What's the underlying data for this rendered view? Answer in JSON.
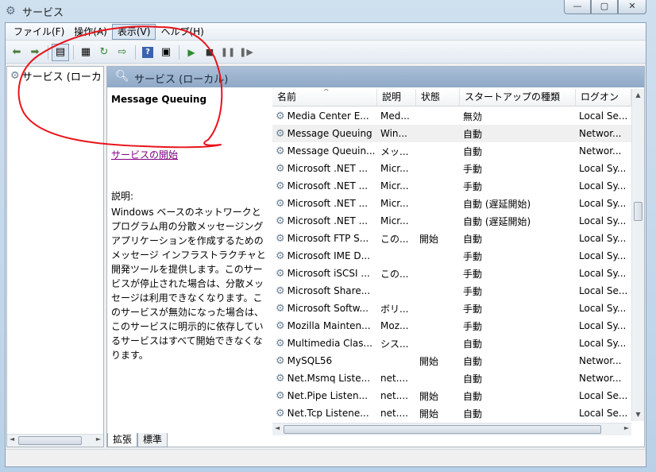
{
  "window": {
    "title": "サービス",
    "controls": {
      "minimize": "—",
      "maximize": "▢",
      "close": "✕"
    }
  },
  "menu": [
    {
      "label": "ファイル(F)"
    },
    {
      "label": "操作(A)"
    },
    {
      "label": "表示(V)"
    },
    {
      "label": "ヘルプ(H)"
    }
  ],
  "tree": {
    "item_label": "サービス (ローカル)"
  },
  "panel": {
    "header_title": "サービス (ローカル)"
  },
  "description": {
    "service_name": "Message Queuing",
    "start_link": "サービスの開始",
    "label": "説明:",
    "text": "Windows ベースのネットワークとプログラム用の分散メッセージング アプリケーションを作成するためのメッセージ インフラストラクチャと開発ツールを提供します。このサービスが停止された場合は、分散メッセージは利用できなくなります。このサービスが無効になった場合は、このサービスに明示的に依存しているサービスはすべて開始できなくなります。"
  },
  "columns": [
    {
      "label": "名前"
    },
    {
      "label": "説明"
    },
    {
      "label": "状態"
    },
    {
      "label": "スタートアップの種類"
    },
    {
      "label": "ログオン"
    }
  ],
  "services": [
    {
      "name": "Media Center E...",
      "desc": "Med...",
      "status": "",
      "startup": "無効",
      "logon": "Local Se..."
    },
    {
      "name": "Message Queuing",
      "desc": "Win...",
      "status": "",
      "startup": "自動",
      "logon": "Networ..."
    },
    {
      "name": "Message Queuin...",
      "desc": "メッ...",
      "status": "",
      "startup": "自動",
      "logon": "Networ..."
    },
    {
      "name": "Microsoft .NET ...",
      "desc": "Micr...",
      "status": "",
      "startup": "手動",
      "logon": "Local Sy..."
    },
    {
      "name": "Microsoft .NET ...",
      "desc": "Micr...",
      "status": "",
      "startup": "手動",
      "logon": "Local Sy..."
    },
    {
      "name": "Microsoft .NET ...",
      "desc": "Micr...",
      "status": "",
      "startup": "自動 (遅延開始)",
      "logon": "Local Sy..."
    },
    {
      "name": "Microsoft .NET ...",
      "desc": "Micr...",
      "status": "",
      "startup": "自動 (遅延開始)",
      "logon": "Local Sy..."
    },
    {
      "name": "Microsoft FTP S...",
      "desc": "この...",
      "status": "開始",
      "startup": "自動",
      "logon": "Local Sy..."
    },
    {
      "name": "Microsoft IME D...",
      "desc": "",
      "status": "",
      "startup": "手動",
      "logon": "Local Sy..."
    },
    {
      "name": "Microsoft iSCSI ...",
      "desc": "この...",
      "status": "",
      "startup": "手動",
      "logon": "Local Sy..."
    },
    {
      "name": "Microsoft Share...",
      "desc": "",
      "status": "",
      "startup": "手動",
      "logon": "Local Se..."
    },
    {
      "name": "Microsoft Softw...",
      "desc": "ボリ...",
      "status": "",
      "startup": "手動",
      "logon": "Local Sy..."
    },
    {
      "name": "Mozilla Mainten...",
      "desc": "Moz...",
      "status": "",
      "startup": "手動",
      "logon": "Local Sy..."
    },
    {
      "name": "Multimedia Clas...",
      "desc": "シス...",
      "status": "",
      "startup": "自動",
      "logon": "Local Sy..."
    },
    {
      "name": "MySQL56",
      "desc": "",
      "status": "開始",
      "startup": "自動",
      "logon": "Networ..."
    },
    {
      "name": "Net.Msmq Liste...",
      "desc": "net....",
      "status": "",
      "startup": "自動",
      "logon": "Networ..."
    },
    {
      "name": "Net.Pipe Listen...",
      "desc": "net....",
      "status": "開始",
      "startup": "自動",
      "logon": "Local Se..."
    },
    {
      "name": "Net.Tcp Listene...",
      "desc": "net....",
      "status": "開始",
      "startup": "自動",
      "logon": "Local Se..."
    }
  ],
  "scroll": {
    "left_arrow": "◄",
    "right_arrow": "►",
    "up_arrow": "▲",
    "down_arrow": "▼"
  },
  "tabs": [
    {
      "label": "拡張"
    },
    {
      "label": "標準"
    }
  ],
  "colors": {
    "annotation": "#e8141b",
    "link_visited": "#800080",
    "header_band": "#9db4cf"
  }
}
